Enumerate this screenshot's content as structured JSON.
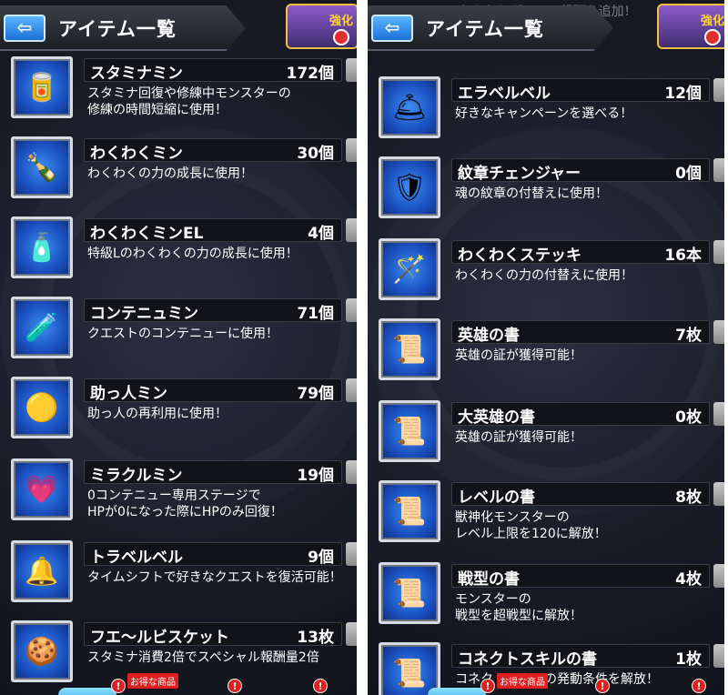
{
  "screens": [
    {
      "header": {
        "title": "アイテム一覧",
        "back_label": "⇦",
        "badge_text": "強化"
      },
      "items": [
        {
          "name": "スタミナミン",
          "count": "172個",
          "desc": "スタミナ回復や修練中モンスターの\n修練の時間短縮に使用！",
          "icon": "stamina-can-icon"
        },
        {
          "name": "わくわくミン",
          "count": "30個",
          "desc": "わくわくの力の成長に使用！",
          "icon": "waku-bottle-icon"
        },
        {
          "name": "わくわくミンEL",
          "count": "4個",
          "desc": "特級Lのわくわくの力の成長に使用！",
          "icon": "waku-el-bottle-icon"
        },
        {
          "name": "コンテニュミン",
          "count": "71個",
          "desc": "クエストのコンテニューに使用！",
          "icon": "continue-potion-icon"
        },
        {
          "name": "助っ人ミン",
          "count": "79個",
          "desc": "助っ人の再利用に使用！",
          "icon": "helper-figure-icon"
        },
        {
          "name": "ミラクルミン",
          "count": "19個",
          "desc": "0コンテニュー専用ステージで\nHPが0になった際にHPのみ回復！",
          "icon": "miracle-heart-potion-icon"
        },
        {
          "name": "トラベルベル",
          "count": "9個",
          "desc": "タイムシフトで好きなクエストを復活可能！",
          "icon": "travel-bell-icon"
        },
        {
          "name": "フエ〜ルビスケット",
          "count": "13枚",
          "desc": "スタミナ消費2倍でスペシャル報酬量2倍",
          "icon": "biscuit-icon"
        }
      ],
      "footer": {
        "tag": "お得な商品",
        "alert": "!"
      }
    },
    {
      "header": {
        "title": "アイテム一覧",
        "back_label": "⇦",
        "badge_text": "強化",
        "sub_text": "おかわりダイス　報酬を追加！"
      },
      "items": [
        {
          "name": "エラベルベル",
          "count": "12個",
          "desc": "好きなキャンペーンを選べる！",
          "icon": "golden-bell-icon"
        },
        {
          "name": "紋章チェンジャー",
          "count": "0個",
          "desc": "魂の紋章の付替えに使用！",
          "icon": "crest-changer-icon"
        },
        {
          "name": "わくわくステッキ",
          "count": "16本",
          "desc": "わくわくの力の付替えに使用！",
          "icon": "waku-stick-icon"
        },
        {
          "name": "英雄の書",
          "count": "7枚",
          "desc": "英雄の証が獲得可能！",
          "icon": "hero-scroll-icon"
        },
        {
          "name": "大英雄の書",
          "count": "0枚",
          "desc": "英雄の証が獲得可能！",
          "icon": "great-hero-scroll-icon"
        },
        {
          "name": "レベルの書",
          "count": "8枚",
          "desc": "獣神化モンスターの\nレベル上限を120に解放！",
          "icon": "level-scroll-icon"
        },
        {
          "name": "戦型の書",
          "count": "4枚",
          "desc": "モンスターの\n戦型を超戦型に解放！",
          "icon": "battle-type-scroll-icon"
        },
        {
          "name": "コネクトスキルの書",
          "count": "1枚",
          "desc": "コネクトスキルの発動条件を解放！",
          "icon": "connect-skill-scroll-icon"
        }
      ],
      "footer": {
        "tag": "お得な商品",
        "alert": "!"
      }
    }
  ]
}
